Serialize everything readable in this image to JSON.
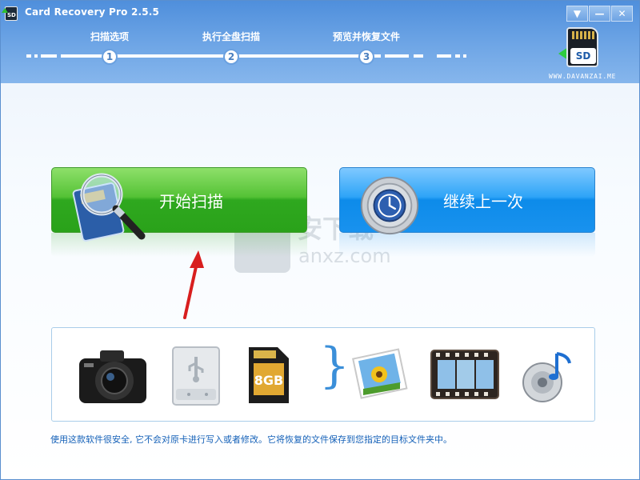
{
  "window": {
    "title": "Card Recovery Pro 2.5.5"
  },
  "window_buttons": {
    "menu": "▼",
    "minimize": "—",
    "close": "✕"
  },
  "steps": [
    {
      "label": "扫描选项",
      "number": "1"
    },
    {
      "label": "执行全盘扫描",
      "number": "2"
    },
    {
      "label": "预览并恢复文件",
      "number": "3"
    }
  ],
  "logo": {
    "card_label": "SD",
    "site": "WWW.DAVANZAI.ME"
  },
  "actions": {
    "start_scan": "开始扫描",
    "continue_last": "继续上一次"
  },
  "watermark": {
    "text": "安下载",
    "sub": "anxz.com"
  },
  "media_icons": [
    "camera-icon",
    "usb-drive-icon",
    "sd-card-8gb-icon",
    "photo-icon",
    "film-icon",
    "music-icon"
  ],
  "sd_card_capacity": "8GB",
  "footer": "使用这款软件很安全, 它不会对原卡进行写入或者修改。它将恢复的文件保存到您指定的目标文件夹中。",
  "colors": {
    "header": "#4f8fdc",
    "start_button": "#3fb12a",
    "continue_button": "#1992ee",
    "footer_text": "#1460b8"
  }
}
